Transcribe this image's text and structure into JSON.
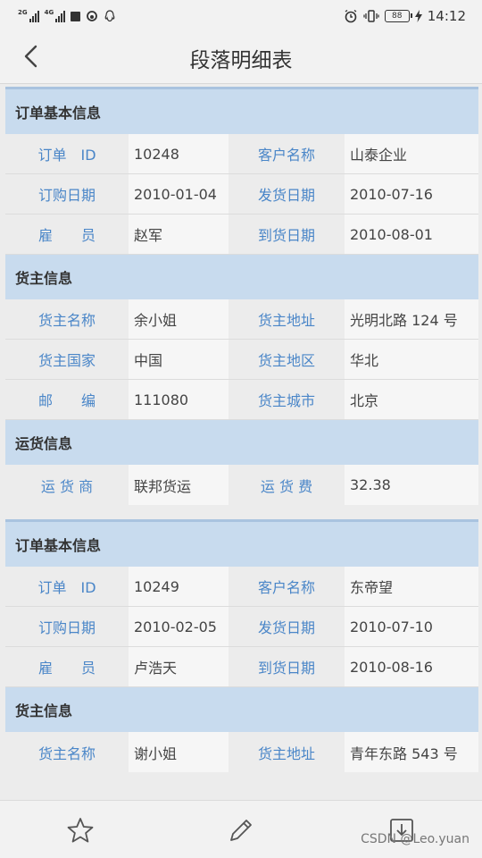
{
  "status": {
    "net1": "2G",
    "net2": "4G",
    "battery": "88",
    "time": "14:12"
  },
  "nav": {
    "title": "段落明细表"
  },
  "orders": [
    {
      "sections": [
        {
          "title": "订单基本信息",
          "rows": [
            {
              "l1": "订单　ID",
              "v1": "10248",
              "l2": "客户名称",
              "v2": "山泰企业"
            },
            {
              "l1": "订购日期",
              "v1": "2010-01-04",
              "l2": "发货日期",
              "v2": "2010-07-16"
            },
            {
              "l1": "雇　　员",
              "v1": "赵军",
              "l2": "到货日期",
              "v2": "2010-08-01"
            }
          ]
        },
        {
          "title": "货主信息",
          "rows": [
            {
              "l1": "货主名称",
              "v1": "余小姐",
              "l2": "货主地址",
              "v2": "光明北路 124 号"
            },
            {
              "l1": "货主国家",
              "v1": "中国",
              "l2": "货主地区",
              "v2": "华北"
            },
            {
              "l1": "邮　　编",
              "v1": "111080",
              "l2": "货主城市",
              "v2": "北京"
            }
          ]
        },
        {
          "title": "运货信息",
          "rows": [
            {
              "l1": "运 货 商",
              "v1": "联邦货运",
              "l2": "运 货 费",
              "v2": "32.38"
            }
          ]
        }
      ]
    },
    {
      "sections": [
        {
          "title": "订单基本信息",
          "rows": [
            {
              "l1": "订单　ID",
              "v1": "10249",
              "l2": "客户名称",
              "v2": "东帝望"
            },
            {
              "l1": "订购日期",
              "v1": "2010-02-05",
              "l2": "发货日期",
              "v2": "2010-07-10"
            },
            {
              "l1": "雇　　员",
              "v1": "卢浩天",
              "l2": "到货日期",
              "v2": "2010-08-16"
            }
          ]
        },
        {
          "title": "货主信息",
          "rows": [
            {
              "l1": "货主名称",
              "v1": "谢小姐",
              "l2": "货主地址",
              "v2": "青年东路 543 号"
            }
          ]
        }
      ]
    }
  ],
  "footer": {
    "watermark": "CSDN @Leo.yuan"
  },
  "colors": {
    "label": "#4a86c8",
    "section_bg": "#c8dbee",
    "card_border": "#a9c3df"
  }
}
